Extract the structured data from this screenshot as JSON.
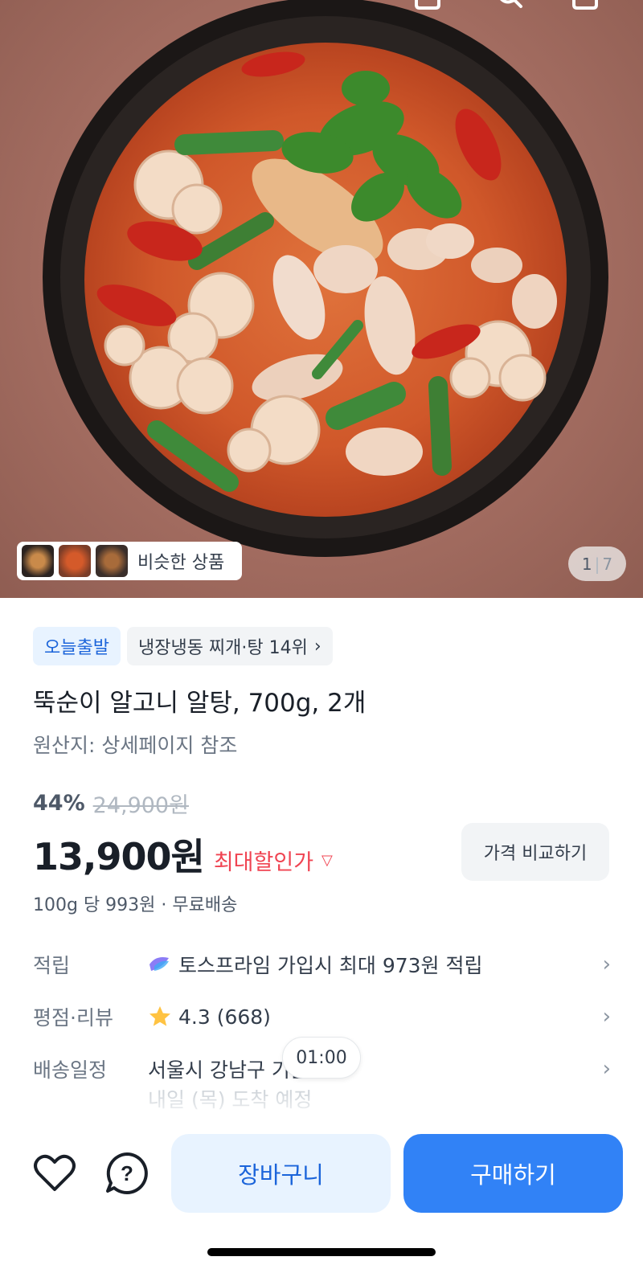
{
  "hero": {
    "image_alt": "stew-photo",
    "similar_label": "비슷한 상품",
    "pager_current": "1",
    "pager_total": "7"
  },
  "badges": {
    "today_ship": "오늘출발",
    "ranking": "냉장냉동 찌개·탕 14위"
  },
  "product": {
    "title": "뚝순이 알고니 알탕, 700g, 2개",
    "origin": "원산지: 상세페이지 참조",
    "discount_pct": "44%",
    "original_price": "24,900원",
    "price": "13,900원",
    "max_discount_label": "최대할인가",
    "compare_label": "가격 비교하기",
    "unit_info": "100g 당 993원 · 무료배송"
  },
  "info": {
    "points_label": "적립",
    "points_value": "토스프라임 가입시 최대 973원 적립",
    "rating_label": "평점·리뷰",
    "rating_value": "4.3 (668)",
    "delivery_label": "배송일정",
    "delivery_value": "서울시 강남구 기준",
    "delivery_sub": "내일 (목) 도착 예정"
  },
  "timer": "01:00",
  "actions": {
    "cart_label": "장바구니",
    "buy_label": "구매하기"
  },
  "colors": {
    "accent": "#3182f6",
    "discount_red": "#f04452",
    "badge_blue_bg": "#e8f3ff"
  }
}
